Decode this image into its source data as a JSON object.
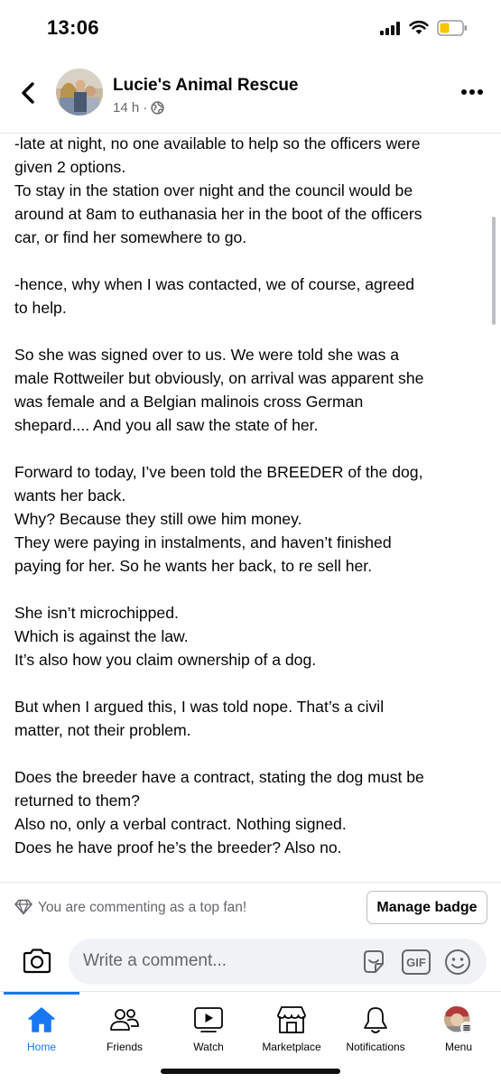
{
  "status": {
    "time": "13:06"
  },
  "header": {
    "page_name": "Lucie's Animal Rescue",
    "time_ago": "14 h",
    "separator": "·"
  },
  "post": {
    "paragraphs": [
      [
        "-late at night, no one available to help so the officers were",
        "given 2 options.",
        "To stay in the station over night and the council would be",
        "around at 8am to euthanasia her in the boot of the officers",
        "car, or find her somewhere to go."
      ],
      [
        "-hence, why when I was contacted, we of course, agreed",
        "to help."
      ],
      [
        "So she was signed over to us. We were told she was a",
        "male Rottweiler but obviously, on arrival was apparent she",
        "was female and a Belgian malinois cross German",
        "shepard.... And you all saw the state of her."
      ],
      [
        "Forward to today, I’ve been told the BREEDER of the dog,",
        "wants her back.",
        "Why? Because they still owe him money.",
        "They were paying in instalments, and haven’t finished",
        "paying for her. So he wants her back, to re sell her."
      ],
      [
        "She isn’t microchipped.",
        "Which is against the law.",
        "It’s also how you claim ownership of a dog."
      ],
      [
        "But when I argued this, I was told nope. That’s a civil",
        "matter, not their problem."
      ],
      [
        "Does the breeder have a contract, stating the dog must be",
        "returned to them?",
        "Also no, only a verbal contract. Nothing signed.",
        "Does he have proof he’s the breeder? Also no."
      ]
    ]
  },
  "fan": {
    "text": "You are commenting as a top fan!",
    "button": "Manage badge"
  },
  "comment": {
    "placeholder": "Write a comment...",
    "gif_label": "GIF"
  },
  "nav": {
    "home": "Home",
    "friends": "Friends",
    "watch": "Watch",
    "marketplace": "Marketplace",
    "notifications": "Notifications",
    "menu": "Menu"
  },
  "colors": {
    "accent": "#1877f2",
    "secondary_text": "#65676b",
    "battery": "#f7c600"
  }
}
